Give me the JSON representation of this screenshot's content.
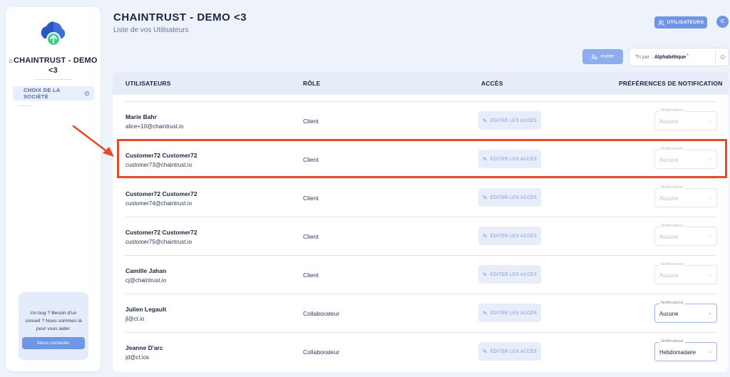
{
  "sidebar": {
    "company_name": "CHAINTRUST - DEMO <3",
    "choose_company": "CHOIX DE LA SOCIÉTÉ",
    "help_text": "Un bug ? Besoin d'un conseil ? Nous sommes là pour vous aider.",
    "contact_label": "Nous contacter"
  },
  "header": {
    "title": "CHAINTRUST - DEMO <3",
    "subtitle": "Liste de vos Utilisateurs",
    "users_button": "UTILISATEURS",
    "avatar_letter": "C"
  },
  "toolbar": {
    "invite_label": "Inviter",
    "sort_label": "Tri par :",
    "sort_value": "Alphabétique"
  },
  "table": {
    "columns": [
      "UTILISATEURS",
      "RÔLE",
      "ACCÈS",
      "PRÉFÉRENCES DE NOTIFICATION"
    ],
    "edit_label": "ÉDITER LES ACCÈS",
    "notif_label": "Notifications",
    "rows": [
      {
        "name": "Marie Bahr",
        "email": "alice+10@chaintrust.io",
        "role": "Client",
        "notification": "Aucune",
        "notif_active": false
      },
      {
        "name": "Customer72 Customer72",
        "email": "customer73@chaintrust.io",
        "role": "Client",
        "notification": "Aucune",
        "notif_active": false
      },
      {
        "name": "Customer72 Customer72",
        "email": "customer74@chaintrust.io",
        "role": "Client",
        "notification": "Aucune",
        "notif_active": false
      },
      {
        "name": "Customer72 Customer72",
        "email": "customer75@chaintrust.io",
        "role": "Client",
        "notification": "Aucune",
        "notif_active": false
      },
      {
        "name": "Camille Jahan",
        "email": "cj@chaintrust.io",
        "role": "Client",
        "notification": "Aucune",
        "notif_active": false
      },
      {
        "name": "Julien Legault",
        "email": "jl@ct.io",
        "role": "Collaborateur",
        "notification": "Aucune",
        "notif_active": true
      },
      {
        "name": "Jeanne D'arc",
        "email": "jd@ct.ios",
        "role": "Collaborateur",
        "notification": "Hebdomadaire",
        "notif_active": true
      }
    ]
  },
  "colors": {
    "accent": "#6f95e6",
    "highlight": "#e84a28",
    "background": "#eef2fb"
  }
}
